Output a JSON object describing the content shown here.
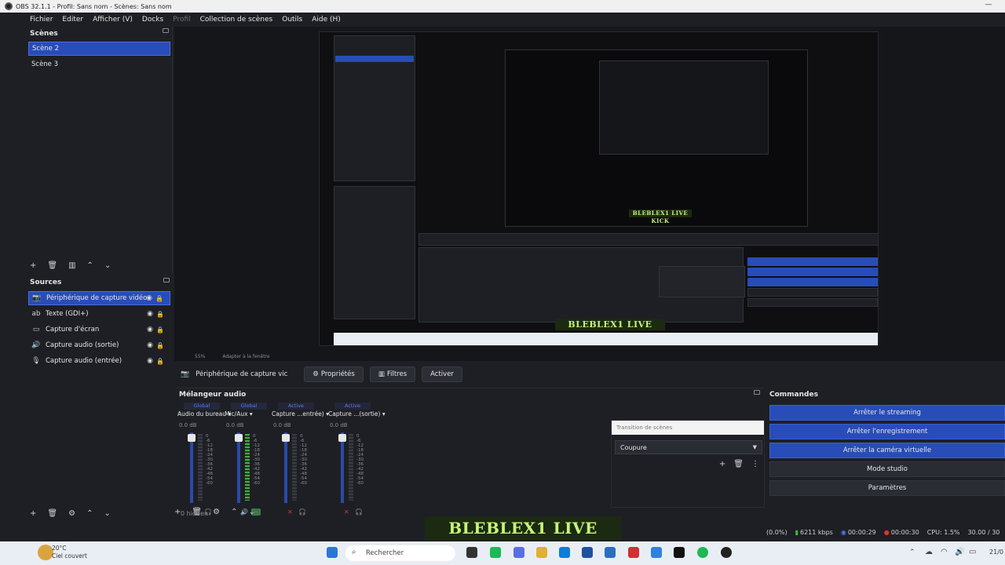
{
  "window": {
    "title": "OBS 32.1.1 - Profil: Sans nom - Scènes: Sans nom"
  },
  "menu": [
    {
      "label": "Fichier",
      "dim": false
    },
    {
      "label": "Editer",
      "dim": false
    },
    {
      "label": "Afficher (V)",
      "dim": false
    },
    {
      "label": "Docks",
      "dim": false
    },
    {
      "label": "Profil",
      "dim": true
    },
    {
      "label": "Collection de scènes",
      "dim": false
    },
    {
      "label": "Outils",
      "dim": false
    },
    {
      "label": "Aide (H)",
      "dim": false
    }
  ],
  "scenes": {
    "title": "Scènes",
    "items": [
      {
        "label": "Scène 2",
        "selected": true
      },
      {
        "label": "Scène 3",
        "selected": false
      }
    ]
  },
  "sources": {
    "title": "Sources",
    "items": [
      {
        "label": "Périphérique de capture vidéo",
        "icon": "camera-icon",
        "selected": true
      },
      {
        "label": "Texte (GDI+)",
        "icon": "text-icon",
        "selected": false
      },
      {
        "label": "Capture d'écran",
        "icon": "monitor-icon",
        "selected": false
      },
      {
        "label": "Capture audio (sortie)",
        "icon": "speaker-icon",
        "selected": false
      },
      {
        "label": "Capture audio (entrée)",
        "icon": "microphone-icon",
        "selected": false
      }
    ]
  },
  "preview": {
    "overlay_text": "BLEBLEX1 LIVE KICK",
    "zoom": "55%",
    "fit_label": "Adapter à la fenêtre"
  },
  "context_bar": {
    "source_label": "Périphérique de capture vic",
    "properties": "Propriétés",
    "filters": "Filtres",
    "activate": "Activer"
  },
  "mixer": {
    "title": "Mélangeur audio",
    "channels": [
      {
        "badge": "Global",
        "name": "Audio du bureau",
        "db": "0.0 dB",
        "live": false
      },
      {
        "badge": "Global",
        "name": "Mic/Aux",
        "db": "0.0 dB",
        "live": true
      },
      {
        "badge": "Active",
        "name": "Capture ...entrée)",
        "db": "0.0 dB",
        "live": false
      },
      {
        "badge": "Active",
        "name": "Capture ...(sortie)",
        "db": "0.0 dB",
        "live": false
      }
    ],
    "scale": [
      "0",
      "-6",
      "-12",
      "-18",
      "-24",
      "-30",
      "-36",
      "-42",
      "-48",
      "-54",
      "-60"
    ],
    "hidden": "0 hidden"
  },
  "transition": {
    "title": "Transition de scènes",
    "selected": "Coupure"
  },
  "commands": {
    "title": "Commandes",
    "items": [
      {
        "label": "Arrêter le streaming",
        "active": true
      },
      {
        "label": "Arrêter l'enregistrement",
        "active": true
      },
      {
        "label": "Arrêter la caméra virtuelle",
        "active": true
      },
      {
        "label": "Mode studio",
        "active": false
      },
      {
        "label": "Paramètres",
        "active": false
      }
    ]
  },
  "status": {
    "dropped": "(0.0%)",
    "bitrate": "6211 kbps",
    "stream_time": "00:00:29",
    "rec_time": "00:00:30",
    "cpu": "CPU: 1.5%",
    "fps": "30.00 / 30"
  },
  "taskbar": {
    "temp": "20°C",
    "weather": "Ciel couvert",
    "search": "Rechercher",
    "date": "21/0"
  },
  "colors": {
    "accent": "#284cb8",
    "bg": "#1e1f24",
    "overlay_text": "#c7f37a"
  }
}
